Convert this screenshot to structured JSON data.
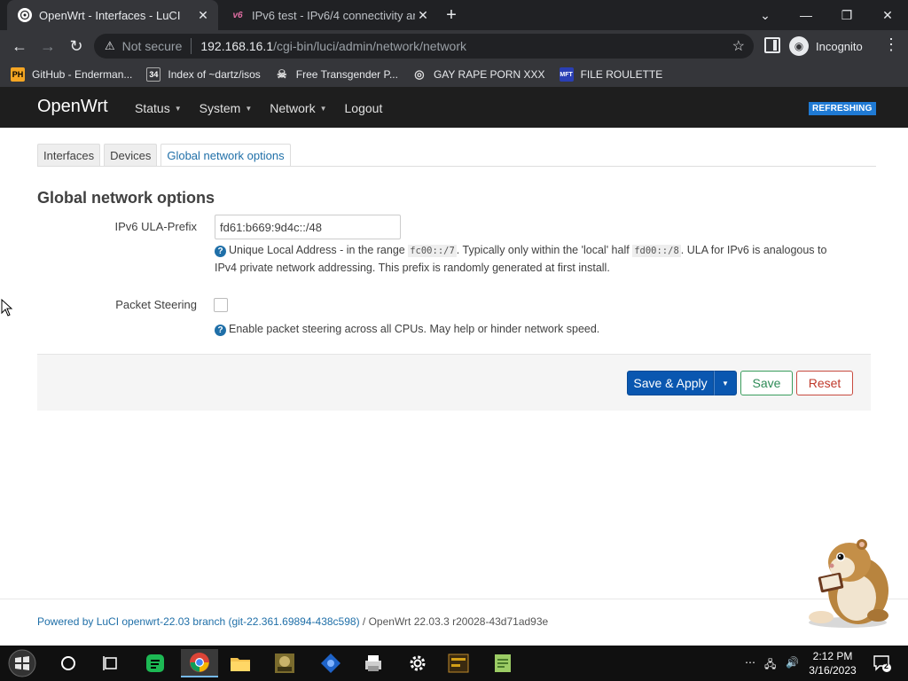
{
  "browser": {
    "tabs": [
      {
        "title": "OpenWrt - Interfaces - LuCI",
        "active": true
      },
      {
        "title": "IPv6 test - IPv6/4 connectivity an",
        "active": false
      }
    ],
    "window_controls": {
      "minimize": "—",
      "restore": "❐",
      "close": "✕",
      "tab_search": "⌄"
    },
    "address": {
      "security_label": "Not secure",
      "host": "192.168.16.1",
      "path": "/cgi-bin/luci/admin/network/network"
    },
    "profile_label": "Incognito",
    "bookmarks": [
      {
        "label": "GitHub - Enderman...",
        "icon": "PH"
      },
      {
        "label": "Index of ~dartz/isos",
        "icon": "34"
      },
      {
        "label": "Free Transgender P...",
        "icon": "skull"
      },
      {
        "label": "GAY RAPE PORN XXX",
        "icon": "globe"
      },
      {
        "label": "FILE ROULETTE",
        "icon": "MFT"
      }
    ]
  },
  "luci": {
    "brand": "OpenWrt",
    "nav": [
      {
        "label": "Status",
        "dropdown": true
      },
      {
        "label": "System",
        "dropdown": true
      },
      {
        "label": "Network",
        "dropdown": true
      },
      {
        "label": "Logout",
        "dropdown": false
      }
    ],
    "indicator": "REFRESHING",
    "tabs": [
      {
        "label": "Interfaces",
        "active": false
      },
      {
        "label": "Devices",
        "active": false
      },
      {
        "label": "Global network options",
        "active": true
      }
    ],
    "section_title": "Global network options",
    "ula": {
      "label": "IPv6 ULA-Prefix",
      "value": "fd61:b669:9d4c::/48",
      "help_pre": "Unique Local Address - in the range ",
      "code1": "fc00::/7",
      "help_mid": ". Typically only within the 'local' half ",
      "code2": "fd00::/8",
      "help_post": ". ULA for IPv6 is analogous to",
      "help_line2": "IPv4 private network addressing. This prefix is randomly generated at first install."
    },
    "packet_steering": {
      "label": "Packet Steering",
      "checked": false,
      "help": "Enable packet steering across all CPUs. May help or hinder network speed."
    },
    "buttons": {
      "save_apply": "Save & Apply",
      "save": "Save",
      "reset": "Reset"
    },
    "footer": {
      "link": "Powered by LuCI openwrt-22.03 branch (git-22.361.69894-438c598)",
      "sep": " / ",
      "version": "OpenWrt 22.03.3 r20028-43d71ad93e"
    }
  },
  "taskbar": {
    "clock_time": "2:12 PM",
    "clock_date": "3/16/2023",
    "notification_count": "2"
  },
  "colors": {
    "luci_header": "#1e1e1e",
    "primary": "#0a57b0",
    "save": "#2e8b57",
    "reset": "#c0392b",
    "link": "#1f6fa8"
  }
}
